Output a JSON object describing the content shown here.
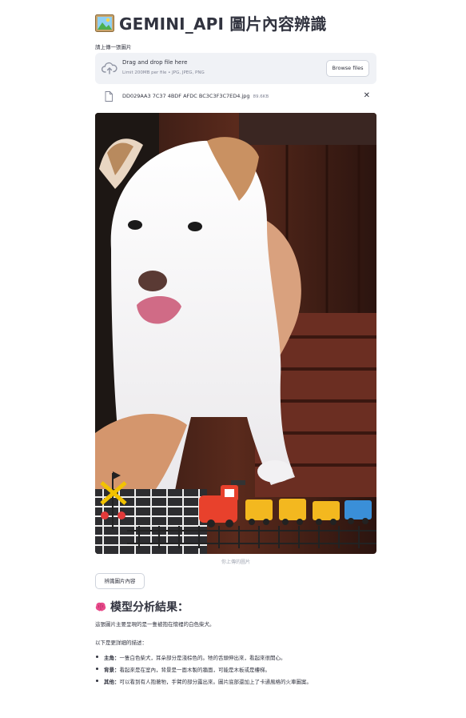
{
  "app": {
    "title": "GEMINI_API 圖片內容辨識",
    "title_icon": "framed-picture-icon"
  },
  "uploader": {
    "label": "請上傳一張圖片",
    "drop_title": "Drag and drop file here",
    "drop_subtitle": "Limit 200MB per file • JPG, JPEG, PNG",
    "browse_label": "Browse files",
    "file_name": "DD029AA3 7C37 4BDF AFDC BC3C3F3C7ED4.jpg",
    "file_size": "89.6KB"
  },
  "image": {
    "caption": "你上傳的圖片"
  },
  "actions": {
    "analyze_label": "辨識圖片內容"
  },
  "results": {
    "heading": "模型分析結果：",
    "heading_icon": "brain-icon",
    "summary": "這張圖片主要呈現的是一隻被抱在懷裡的白色柴犬。",
    "details_intro": "以下是更詳細的描述：",
    "items": [
      {
        "key": "主角：",
        "text": "一隻白色柴犬，耳朵部分是淺棕色的。牠的舌頭伸出來，看起來很開心。"
      },
      {
        "key": "背景：",
        "text": "看起來是在室內，背景是一面木製的牆面，可能是木板或是樓梯。"
      },
      {
        "key": "其他：",
        "text": "可以看到有人抱著牠，手臂的部分露出來。圖片底部還加上了卡通風格的火車圖案。"
      }
    ]
  },
  "colors": {
    "text": "#31333f",
    "muted": "#808495",
    "dropzone_bg": "#f0f2f6",
    "brain_pink": "#e84a8a"
  }
}
